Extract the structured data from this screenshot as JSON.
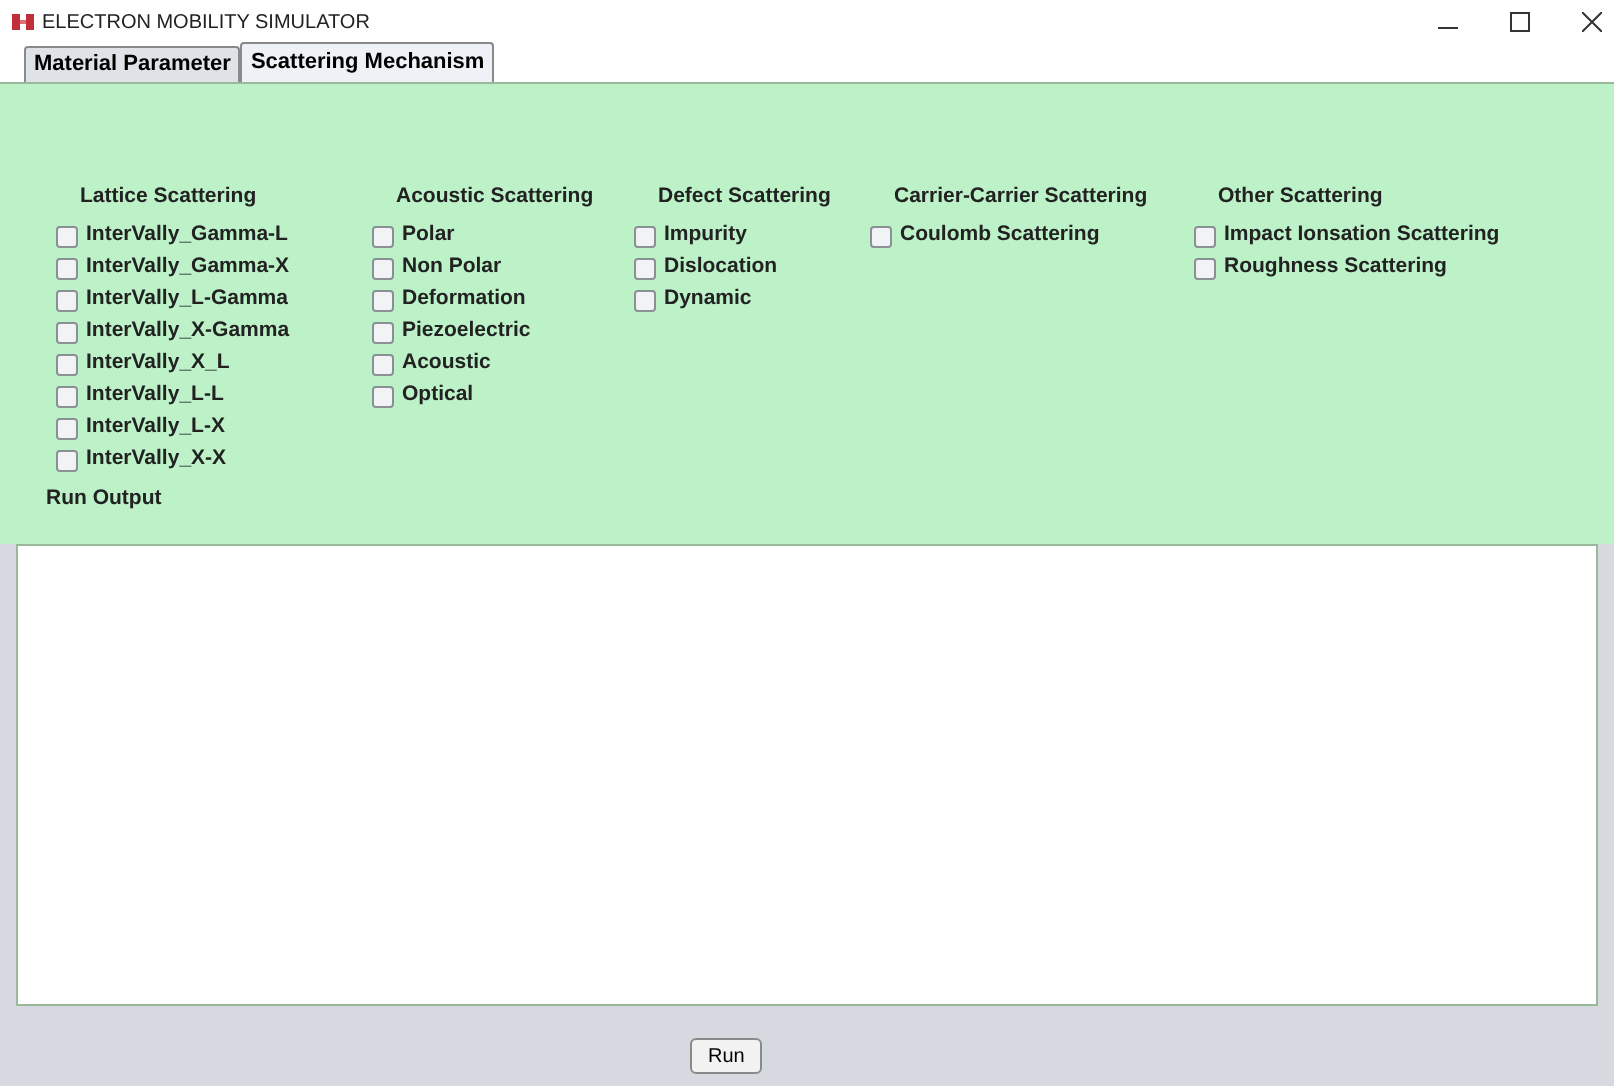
{
  "window": {
    "title": "ELECTRON MOBILITY SIMULATOR"
  },
  "tabs": [
    {
      "label": "Material Parameter",
      "selected": false
    },
    {
      "label": "Scattering Mechanism",
      "selected": true
    }
  ],
  "groups": [
    {
      "title": "Lattice Scattering",
      "options": [
        {
          "label": "InterVally_Gamma-L",
          "checked": false
        },
        {
          "label": "InterVally_Gamma-X",
          "checked": false
        },
        {
          "label": "InterVally_L-Gamma",
          "checked": false
        },
        {
          "label": "InterVally_X-Gamma",
          "checked": false
        },
        {
          "label": "InterVally_X_L",
          "checked": false
        },
        {
          "label": "InterVally_L-L",
          "checked": false
        },
        {
          "label": "InterVally_L-X",
          "checked": false
        },
        {
          "label": "InterVally_X-X",
          "checked": false
        }
      ]
    },
    {
      "title": "Acoustic Scattering",
      "options": [
        {
          "label": "Polar",
          "checked": false
        },
        {
          "label": "Non Polar",
          "checked": false
        },
        {
          "label": "Deformation",
          "checked": false
        },
        {
          "label": "Piezoelectric",
          "checked": false
        },
        {
          "label": "Acoustic",
          "checked": false
        },
        {
          "label": "Optical",
          "checked": false
        }
      ]
    },
    {
      "title": "Defect Scattering",
      "options": [
        {
          "label": "Impurity",
          "checked": false
        },
        {
          "label": "Dislocation",
          "checked": false
        },
        {
          "label": "Dynamic",
          "checked": false
        }
      ]
    },
    {
      "title": "Carrier-Carrier Scattering",
      "options": [
        {
          "label": "Coulomb Scattering",
          "checked": false
        }
      ]
    },
    {
      "title": "Other Scattering",
      "options": [
        {
          "label": "Impact Ionsation Scattering",
          "checked": false
        },
        {
          "label": "Roughness Scattering",
          "checked": false
        }
      ]
    }
  ],
  "output_label": "Run Output",
  "run_button": "Run"
}
